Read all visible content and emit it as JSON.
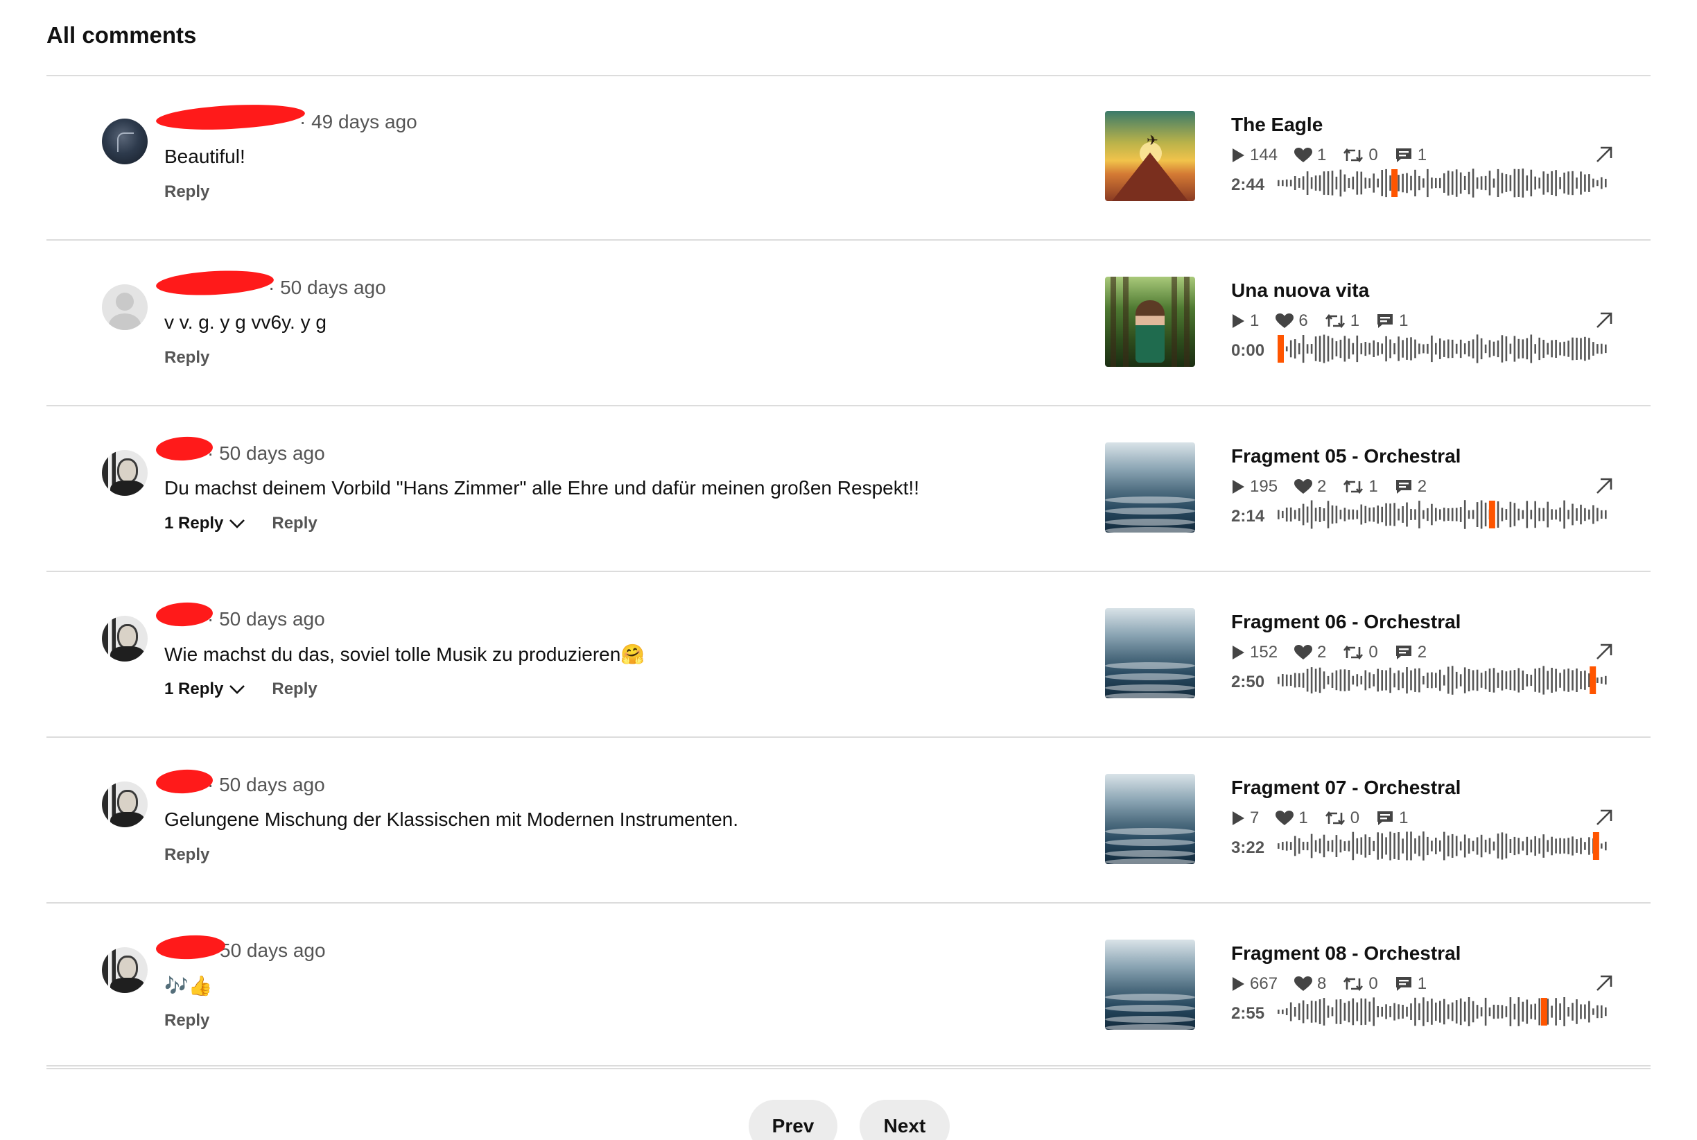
{
  "header": {
    "title": "All comments"
  },
  "comments": [
    {
      "time_suffix": " · 49 days ago",
      "text": "Beautiful!",
      "replies_label": "",
      "reply_label": "Reply",
      "track": {
        "title": "The Eagle",
        "plays": "144",
        "likes": "1",
        "reposts": "0",
        "comments": "1",
        "time": "2:44",
        "progress": 0.35
      }
    },
    {
      "time_suffix": " · 50 days ago",
      "text": "v v. g. y g vv6y. y g",
      "replies_label": "",
      "reply_label": "Reply",
      "track": {
        "title": "Una nuova vita",
        "plays": "1",
        "likes": "6",
        "reposts": "1",
        "comments": "1",
        "time": "0:00",
        "progress": 0.0
      }
    },
    {
      "time_suffix": " · 50 days ago",
      "text": "Du machst deinem Vorbild \"Hans Zimmer\" alle Ehre und dafür meinen großen Respekt!!",
      "replies_label": "1 Reply",
      "reply_label": "Reply",
      "track": {
        "title": "Fragment 05 - Orchestral",
        "plays": "195",
        "likes": "2",
        "reposts": "1",
        "comments": "2",
        "time": "2:14",
        "progress": 0.65
      }
    },
    {
      "time_suffix": " · 50 days ago",
      "text": "Wie machst du das, soviel tolle Musik zu produzieren🤗",
      "replies_label": "1 Reply",
      "reply_label": "Reply",
      "track": {
        "title": "Fragment 06 - Orchestral",
        "plays": "152",
        "likes": "2",
        "reposts": "0",
        "comments": "2",
        "time": "2:50",
        "progress": 0.96
      }
    },
    {
      "time_suffix": " · 50 days ago",
      "text": "Gelungene Mischung der Klassischen mit Modernen Instrumenten.",
      "replies_label": "",
      "reply_label": "Reply",
      "track": {
        "title": "Fragment 07 - Orchestral",
        "plays": "7",
        "likes": "1",
        "reposts": "0",
        "comments": "1",
        "time": "3:22",
        "progress": 0.97
      }
    },
    {
      "time_suffix": " 50 days ago",
      "text": "🎶👍",
      "replies_label": "",
      "reply_label": "Reply",
      "track": {
        "title": "Fragment 08 - Orchestral",
        "plays": "667",
        "likes": "8",
        "reposts": "0",
        "comments": "1",
        "time": "2:55",
        "progress": 0.81
      }
    }
  ],
  "pagination": {
    "prev_label": "Prev",
    "next_label": "Next"
  },
  "colors": {
    "accent": "#ff5500",
    "redaction": "#ff1a1a",
    "wave_bar": "#555555"
  },
  "icons": {
    "play": "play-icon",
    "like": "heart-icon",
    "repost": "repost-icon",
    "comment": "comment-icon",
    "open": "arrow-up-right-icon",
    "expand": "chevron-down-icon"
  }
}
